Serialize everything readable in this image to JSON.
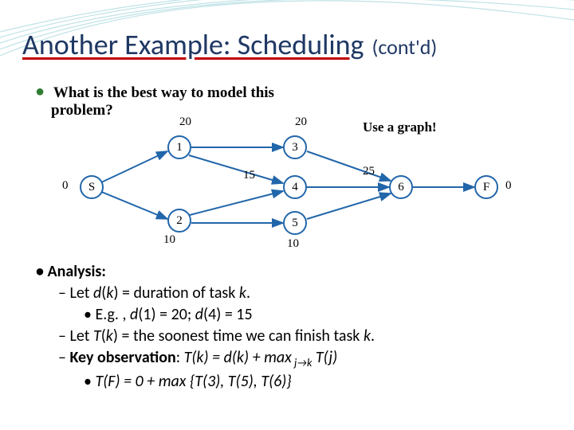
{
  "slide": {
    "title_main": "Another Example: Scheduling",
    "title_sub": "(cont'd)",
    "question_l1": "What is the best way to model this",
    "question_l2": "problem?",
    "hint": "Use a graph!"
  },
  "graph": {
    "nodes": {
      "S": "S",
      "n1": "1",
      "n2": "2",
      "n3": "3",
      "n4": "4",
      "n5": "5",
      "n6": "6",
      "F": "F"
    },
    "labels": {
      "l0a": "0",
      "l0b": "0",
      "l20a": "20",
      "l20b": "20",
      "l15": "15",
      "l25": "25",
      "l10a": "10",
      "l10b": "10"
    },
    "adjacency_note": "S→1,2; 1→3,4; 2→4,5; 3,4,5→6; 6→F",
    "durations": {
      "S": 0,
      "1": 20,
      "2": 10,
      "3": 20,
      "4": 15,
      "5": 10,
      "6": 25,
      "F": 0
    }
  },
  "analysis": {
    "head": "Analysis:",
    "line1_a": "Let ",
    "line1_b": "(",
    "line1_c": ") = duration of task ",
    "line2_a": "E.g. , ",
    "line2_b": "(1) = 20; ",
    "line2_c": "(4) = 15",
    "line3_a": "Let ",
    "line3_b": "(",
    "line3_c": ") = the soonest time we can finish task ",
    "line4_a": "Key observation",
    "line4_b": ": ",
    "formula_lhs": "T(k) = d(k) + max",
    "formula_sub": " j→k",
    "formula_rhs": " T(j)",
    "line5": "T(F) = 0 + max {T(3), T(5), T(6)}"
  },
  "vars": {
    "d": "d",
    "k": "k",
    "T": "T"
  }
}
